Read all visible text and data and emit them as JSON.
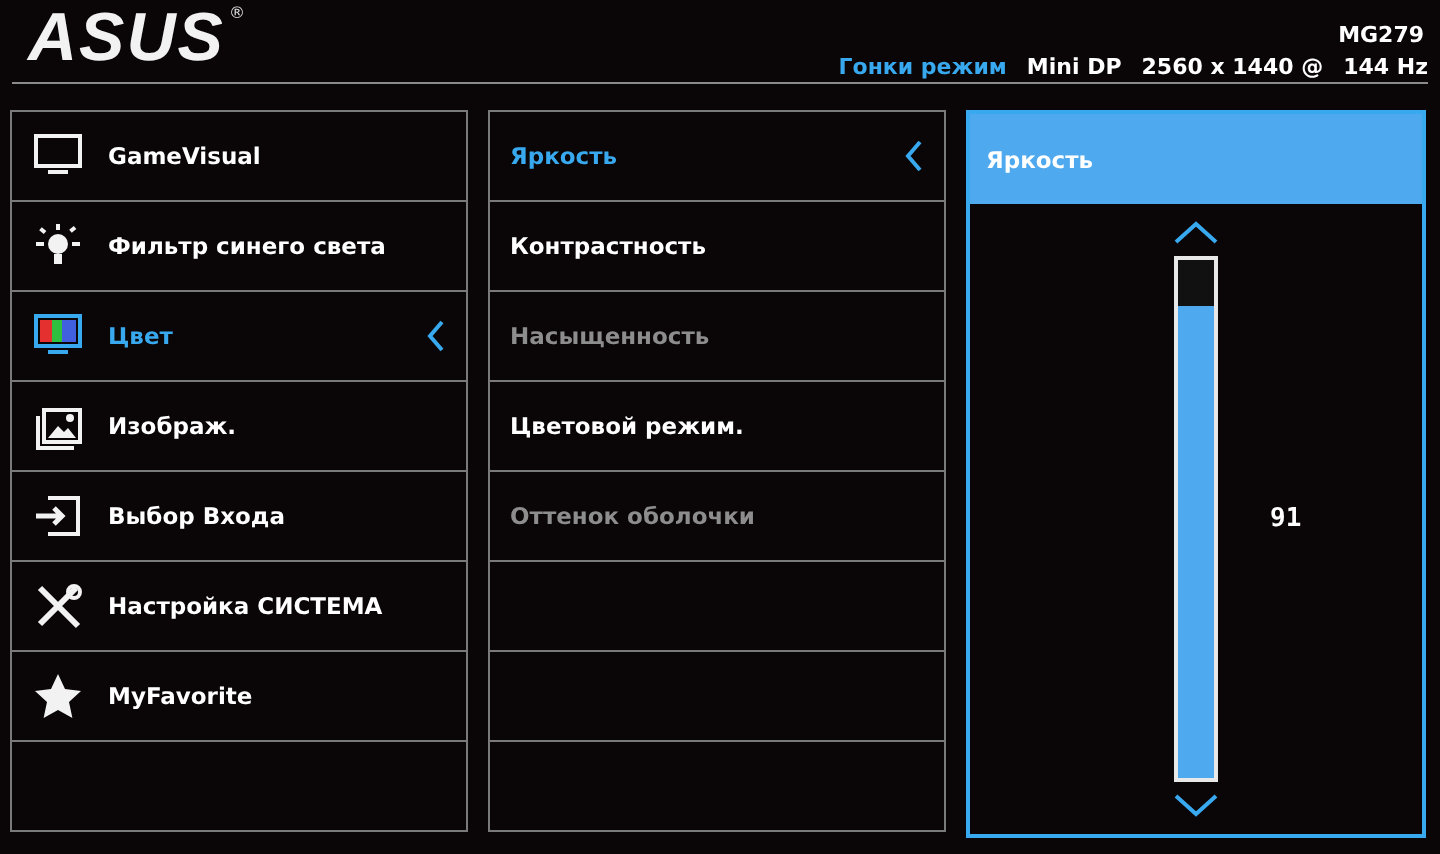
{
  "header": {
    "logo": "ASUS",
    "registered": "®",
    "model": "MG279",
    "mode": "Гонки режим",
    "input": "Mini DP",
    "resolution": "2560 x 1440 @",
    "refresh": "144 Hz"
  },
  "main_menu": [
    {
      "label": "GameVisual",
      "kind": "gamevisual",
      "selected": false
    },
    {
      "label": "Фильтр синего света",
      "kind": "bluelight",
      "selected": false
    },
    {
      "label": "Цвет",
      "kind": "color",
      "selected": true
    },
    {
      "label": "Изображ.",
      "kind": "image",
      "selected": false
    },
    {
      "label": "Выбор Входа",
      "kind": "input",
      "selected": false
    },
    {
      "label": "Настройка СИСТЕМА",
      "kind": "system",
      "selected": false
    },
    {
      "label": "MyFavorite",
      "kind": "favorite",
      "selected": false
    }
  ],
  "sub_menu": [
    {
      "label": "Яркость",
      "selected": true,
      "disabled": false
    },
    {
      "label": "Контрастность",
      "selected": false,
      "disabled": false
    },
    {
      "label": "Насыщенность",
      "selected": false,
      "disabled": true
    },
    {
      "label": "Цветовой режим.",
      "selected": false,
      "disabled": false
    },
    {
      "label": "Оттенок оболочки",
      "selected": false,
      "disabled": true
    }
  ],
  "value_panel": {
    "title": "Яркость",
    "level": 0.91,
    "reading": "91"
  }
}
